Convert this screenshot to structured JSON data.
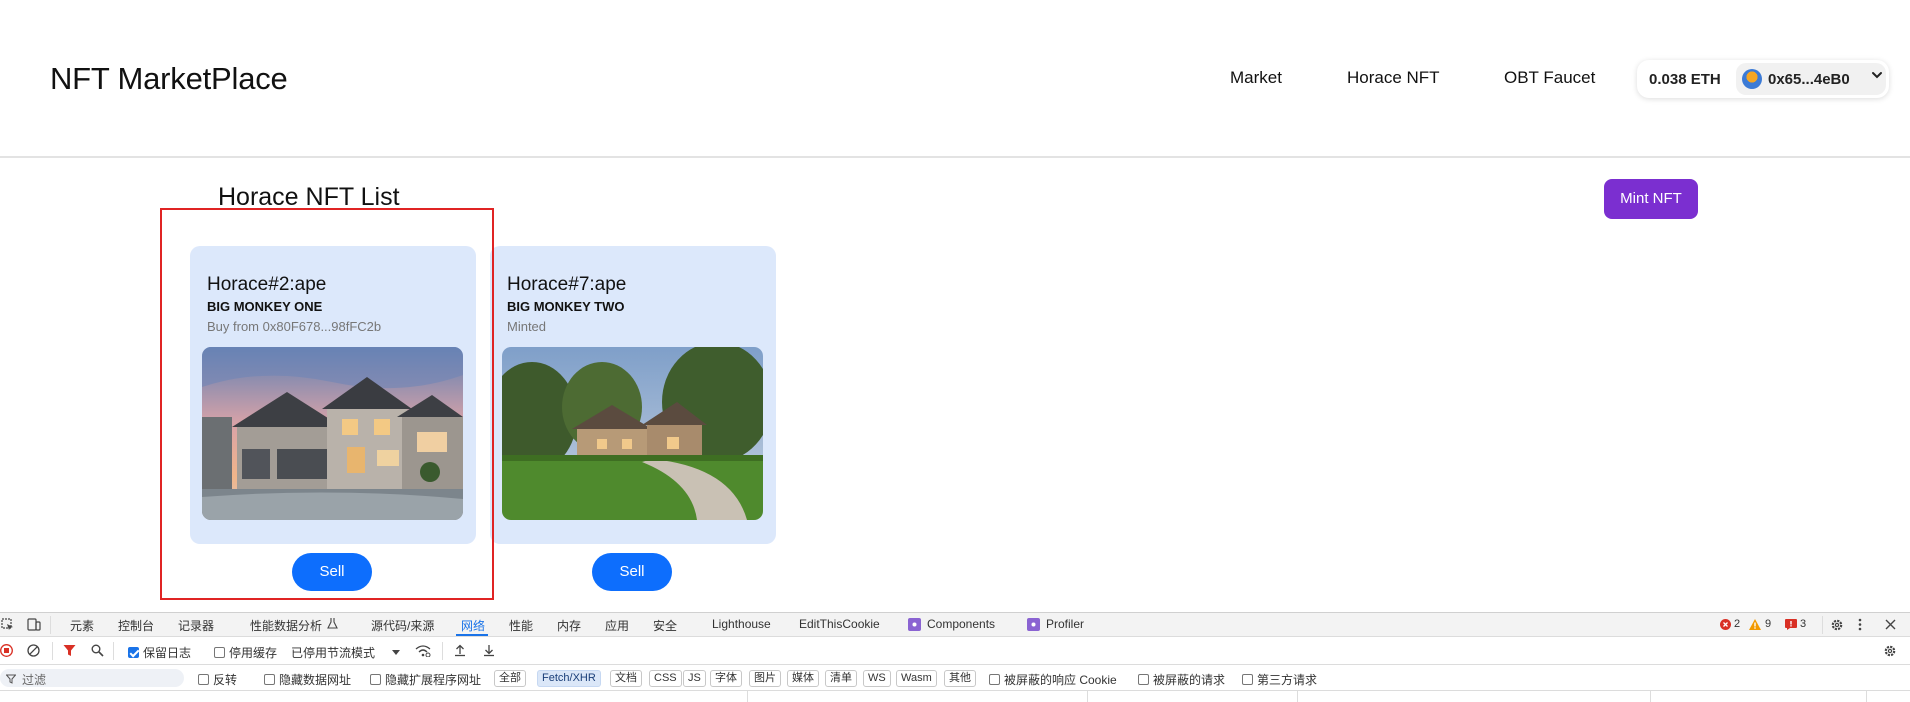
{
  "header": {
    "brand": "NFT MarketPlace",
    "nav": [
      "Market",
      "Horace NFT",
      "OBT Faucet"
    ],
    "wallet": {
      "balance": "0.038 ETH",
      "address": "0x65...4eB0"
    }
  },
  "main": {
    "title": "Horace NFT List",
    "mint_label": "Mint NFT",
    "cards": [
      {
        "title": "Horace#2:ape",
        "subtitle": "BIG MONKEY ONE",
        "status": "Buy from 0x80F678...98fFC2b",
        "button": "Sell"
      },
      {
        "title": "Horace#7:ape",
        "subtitle": "BIG MONKEY TWO",
        "status": "Minted",
        "button": "Sell"
      }
    ]
  },
  "devtools": {
    "tabs": [
      "元素",
      "控制台",
      "记录器",
      "性能数据分析",
      "源代码/来源",
      "网络",
      "性能",
      "内存",
      "应用",
      "安全",
      "Lighthouse",
      "EditThisCookie",
      "Components",
      "Profiler"
    ],
    "active_tab": "网络",
    "errors": "2",
    "warnings": "9",
    "issues": "3",
    "toolbar": {
      "preserve_log": "保留日志",
      "disable_cache": "停用缓存",
      "throttle": "已停用节流模式"
    },
    "filter": {
      "placeholder": "过滤",
      "invert": "反转",
      "hide_data_urls": "隐藏数据网址",
      "hide_ext_urls": "隐藏扩展程序网址",
      "types": [
        "全部",
        "Fetch/XHR",
        "文档",
        "CSS",
        "JS",
        "字体",
        "图片",
        "媒体",
        "清单",
        "WS",
        "Wasm",
        "其他"
      ],
      "active_type": "Fetch/XHR",
      "blocked_cookies": "被屏蔽的响应 Cookie",
      "blocked_requests": "被屏蔽的请求",
      "third_party": "第三方请求"
    }
  },
  "colors": {
    "accent_purple": "#7b2fd0",
    "button_blue": "#0d6efd",
    "card_bg": "#dce8fb",
    "highlight_red": "#e02424"
  }
}
